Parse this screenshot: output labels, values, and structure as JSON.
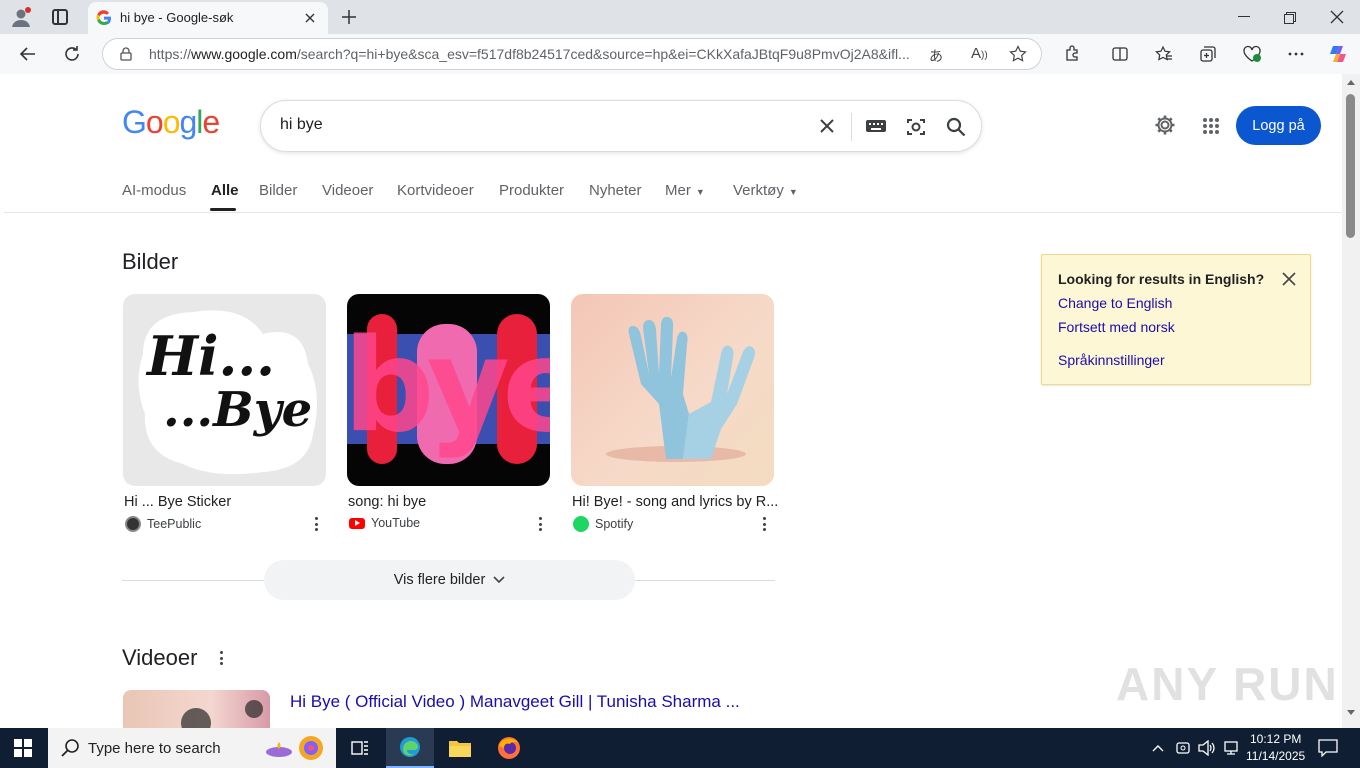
{
  "browser": {
    "tab_title": "hi bye - Google-søk",
    "url_prefix": "https://",
    "url_host": "www.google.com",
    "url_rest": "/search?q=hi+bye&sca_esv=f517df8b24517ced&source=hp&ei=CKkXafaJBtqF9u8PmvOj2A8&ifl..."
  },
  "header": {
    "logo": "Google",
    "search_value": "hi bye",
    "login_label": "Logg på"
  },
  "nav": {
    "tabs": [
      "AI-modus",
      "Alle",
      "Bilder",
      "Videoer",
      "Kortvideoer",
      "Produkter",
      "Nyheter",
      "Mer",
      "Verktøy"
    ],
    "active": "Alle"
  },
  "images_section": {
    "heading": "Bilder",
    "cards": [
      {
        "title": "Hi ... Bye Sticker",
        "source": "TeePublic"
      },
      {
        "title": "song: hi bye",
        "source": "YouTube"
      },
      {
        "title": "Hi! Bye! - song and lyrics by R...",
        "source": "Spotify"
      }
    ],
    "more_label": "Vis flere bilder",
    "sticker_text_1": "Hi...",
    "sticker_text_2": "...Bye",
    "art_text": "bye"
  },
  "videos_section": {
    "heading": "Videoer",
    "first_title": "Hi Bye ( Official Video ) Manavgeet Gill | Tunisha Sharma ..."
  },
  "lang_box": {
    "title": "Looking for results in English?",
    "link1": "Change to English",
    "link2": "Fortsett med norsk",
    "link3": "Språkinnstillinger"
  },
  "taskbar": {
    "search_placeholder": "Type here to search",
    "time": "10:12 PM",
    "date": "11/14/2025"
  },
  "watermark": "ANY RUN",
  "colors": {
    "accent": "#0b57d0",
    "link": "#1a0dab",
    "infobox": "#fef7d6"
  }
}
